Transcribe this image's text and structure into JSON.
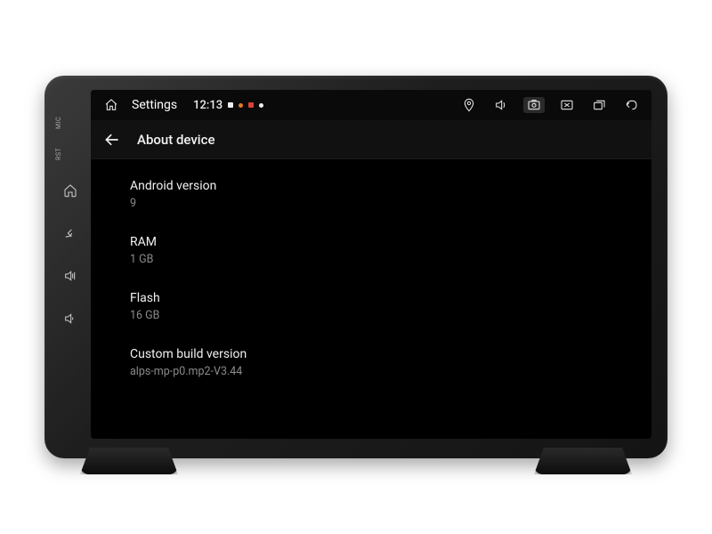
{
  "bezel": {
    "mic": "MIC",
    "rst": "RST"
  },
  "statusbar": {
    "title": "Settings",
    "time": "12:13"
  },
  "header": {
    "title": "About device"
  },
  "about": {
    "items": [
      {
        "label": "Android version",
        "value": "9"
      },
      {
        "label": "RAM",
        "value": "1 GB"
      },
      {
        "label": "Flash",
        "value": "16 GB"
      },
      {
        "label": "Custom build version",
        "value": "alps-mp-p0.mp2-V3.44"
      }
    ]
  }
}
